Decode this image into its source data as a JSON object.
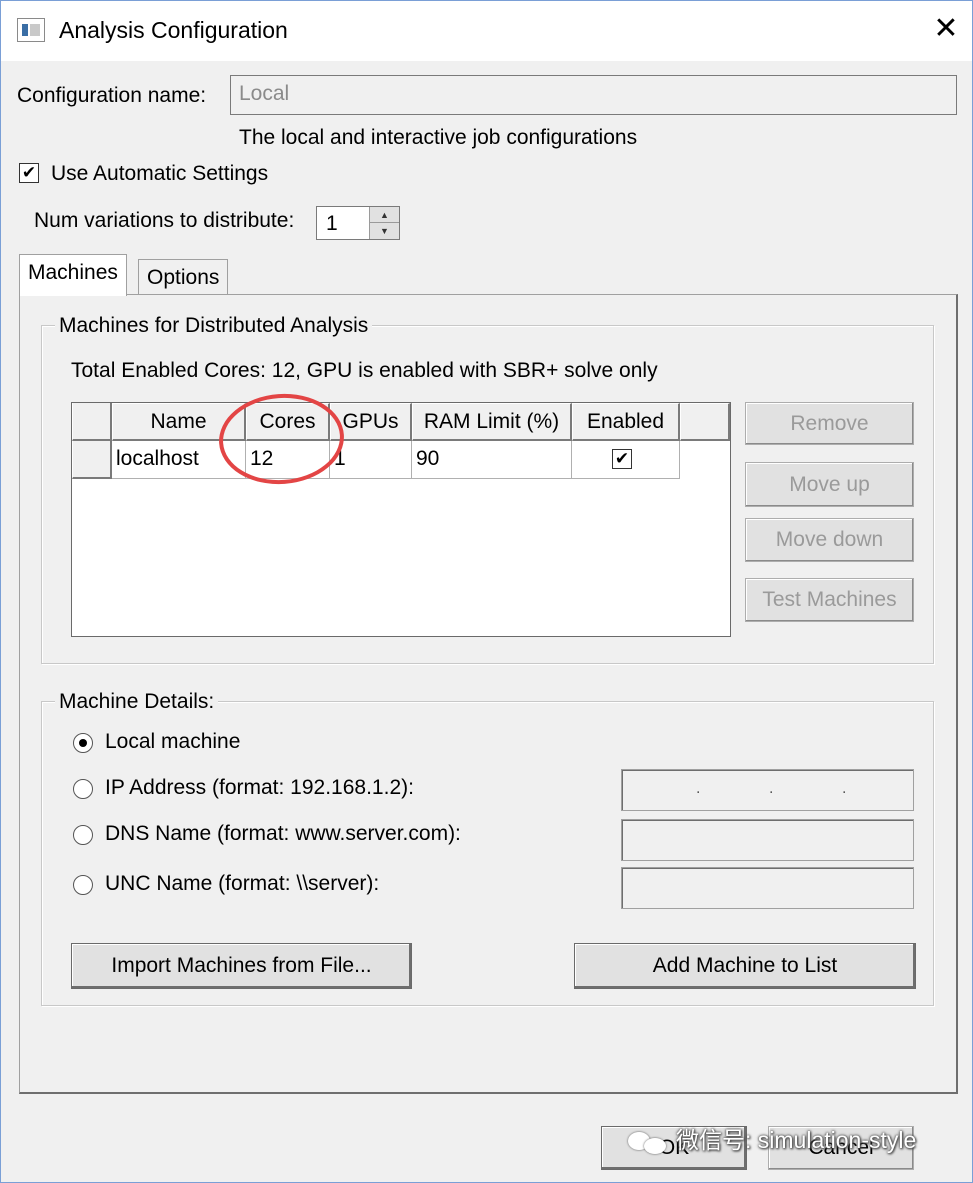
{
  "window": {
    "title": "Analysis Configuration",
    "close_glyph": "✕"
  },
  "config": {
    "name_label": "Configuration name:",
    "name_value": "Local",
    "description": "The local and interactive job configurations",
    "use_automatic_label": "Use Automatic Settings",
    "use_automatic_checked": true,
    "num_variations_label": "Num variations to distribute:",
    "num_variations_value": "1"
  },
  "tabs": [
    {
      "label": "Machines",
      "active": true
    },
    {
      "label": "Options",
      "active": false
    }
  ],
  "machines_group": {
    "label": "Machines for Distributed Analysis",
    "summary": "Total Enabled Cores: 12, GPU is enabled with SBR+ solve only",
    "columns": [
      "Name",
      "Cores",
      "GPUs",
      "RAM Limit (%)",
      "Enabled"
    ],
    "rows": [
      {
        "name": "localhost",
        "cores": "12",
        "gpus": "1",
        "ram_limit": "90",
        "enabled": true
      }
    ],
    "checkmark": "✔"
  },
  "side_buttons": {
    "remove": "Remove",
    "move_up": "Move up",
    "move_down": "Move down",
    "test_machines": "Test Machines"
  },
  "details_group": {
    "label": "Machine Details:",
    "options": {
      "local": "Local machine",
      "ip": "IP Address (format: 192.168.1.2):",
      "dns": "DNS Name (format: www.server.com):",
      "unc": "UNC Name (format: \\\\server):"
    },
    "selected": "local",
    "ip_dots": ".",
    "import_button": "Import Machines from File...",
    "add_button": "Add Machine to List"
  },
  "footer": {
    "ok": "OK",
    "cancel": "Cancel"
  },
  "watermark": {
    "text": "微信号: simulation-style"
  },
  "colors": {
    "annotation_circle": "#e34545",
    "window_border": "#7a9fd6",
    "disabled_text": "#9a9a9a"
  }
}
